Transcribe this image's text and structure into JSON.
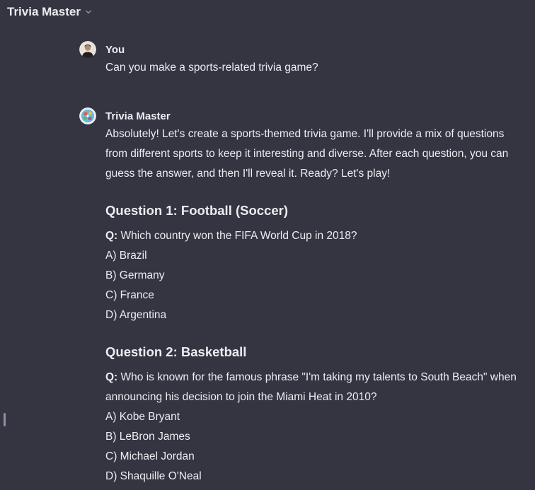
{
  "header": {
    "title": "Trivia Master"
  },
  "conversation": {
    "user_message": {
      "author": "You",
      "text": "Can you make a sports-related trivia game?"
    },
    "bot_message": {
      "author": "Trivia Master",
      "intro": "Absolutely! Let's create a sports-themed trivia game. I'll provide a mix of questions from different sports to keep it interesting and diverse. After each question, you can guess the answer, and then I'll reveal it. Ready? Let's play!",
      "questions": [
        {
          "heading": "Question 1: Football (Soccer)",
          "q_label": "Q:",
          "q_text": " Which country won the FIFA World Cup in 2018?",
          "options": [
            "A) Brazil",
            "B) Germany",
            "C) France",
            "D) Argentina"
          ]
        },
        {
          "heading": "Question 2: Basketball",
          "q_label": "Q:",
          "q_text": " Who is known for the famous phrase \"I'm taking my talents to South Beach\" when announcing his decision to join the Miami Heat in 2010?",
          "options": [
            "A) Kobe Bryant",
            "B) LeBron James",
            "C) Michael Jordan",
            "D) Shaquille O'Neal"
          ]
        }
      ]
    }
  }
}
